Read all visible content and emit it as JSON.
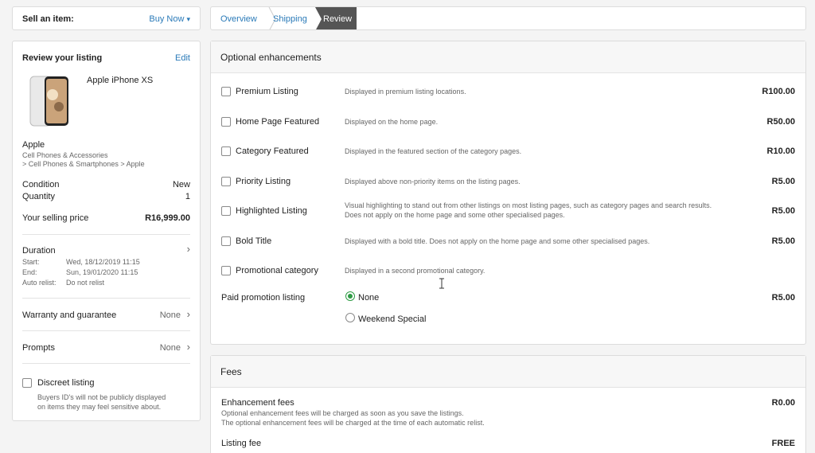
{
  "sell_bar": {
    "label": "Sell an item:",
    "mode": "Buy Now",
    "caret": "▾"
  },
  "breadcrumb": {
    "steps": [
      "Overview",
      "Shipping",
      "Review"
    ]
  },
  "review": {
    "title": "Review your listing",
    "edit": "Edit",
    "item_title": "Apple iPhone XS",
    "brand": "Apple",
    "category_line1": "Cell Phones & Accessories",
    "category_line2": "> Cell Phones & Smartphones > Apple",
    "condition_label": "Condition",
    "condition_value": "New",
    "quantity_label": "Quantity",
    "quantity_value": "1",
    "price_label": "Your selling price",
    "price_value": "R16,999.00",
    "duration_label": "Duration",
    "start_label": "Start:",
    "start_value": "Wed, 18/12/2019 11:15",
    "end_label": "End:",
    "end_value": "Sun, 19/01/2020 11:15",
    "relist_label": "Auto relist:",
    "relist_value": "Do not relist",
    "warranty_label": "Warranty and guarantee",
    "warranty_value": "None",
    "prompts_label": "Prompts",
    "prompts_value": "None",
    "discreet_label": "Discreet listing",
    "discreet_note1": "Buyers ID's will not be publicly displayed",
    "discreet_note2": "on items they may feel sensitive about."
  },
  "enhancements": {
    "title": "Optional enhancements",
    "items": [
      {
        "label": "Premium Listing",
        "desc": "Displayed in premium listing locations.",
        "desc2": "",
        "price": "R100.00"
      },
      {
        "label": "Home Page Featured",
        "desc": "Displayed on the home page.",
        "desc2": "",
        "price": "R50.00"
      },
      {
        "label": "Category Featured",
        "desc": "Displayed in the featured section of the category pages.",
        "desc2": "",
        "price": "R10.00"
      },
      {
        "label": "Priority Listing",
        "desc": "Displayed above non-priority items on the listing pages.",
        "desc2": "",
        "price": "R5.00"
      },
      {
        "label": "Highlighted Listing",
        "desc": "Visual highlighting to stand out from other listings on most listing pages, such as category pages and search results.",
        "desc2": "Does not apply on the home page and some other specialised pages.",
        "price": "R5.00"
      },
      {
        "label": "Bold Title",
        "desc": "Displayed with a bold title. Does not apply on the home page and some other specialised pages.",
        "desc2": "",
        "price": "R5.00"
      },
      {
        "label": "Promotional category",
        "desc": "Displayed in a second promotional category.",
        "desc2": "",
        "price": ""
      }
    ],
    "paid_promotion": {
      "label": "Paid promotion listing",
      "options": [
        "None",
        "Weekend Special"
      ],
      "selected": "None",
      "price": "R5.00"
    }
  },
  "fees": {
    "title": "Fees",
    "enhancement_label": "Enhancement fees",
    "enhancement_value": "R0.00",
    "note1": "Optional enhancement fees will be charged as soon as you save the listings.",
    "note2": "The optional enhancement fees will be charged at the time of each automatic relist.",
    "listing_label": "Listing fee",
    "listing_value": "FREE"
  },
  "colors": {
    "accent": "#2a7ab8",
    "radio_selected": "#2e9b44",
    "active_step": "#555555"
  }
}
